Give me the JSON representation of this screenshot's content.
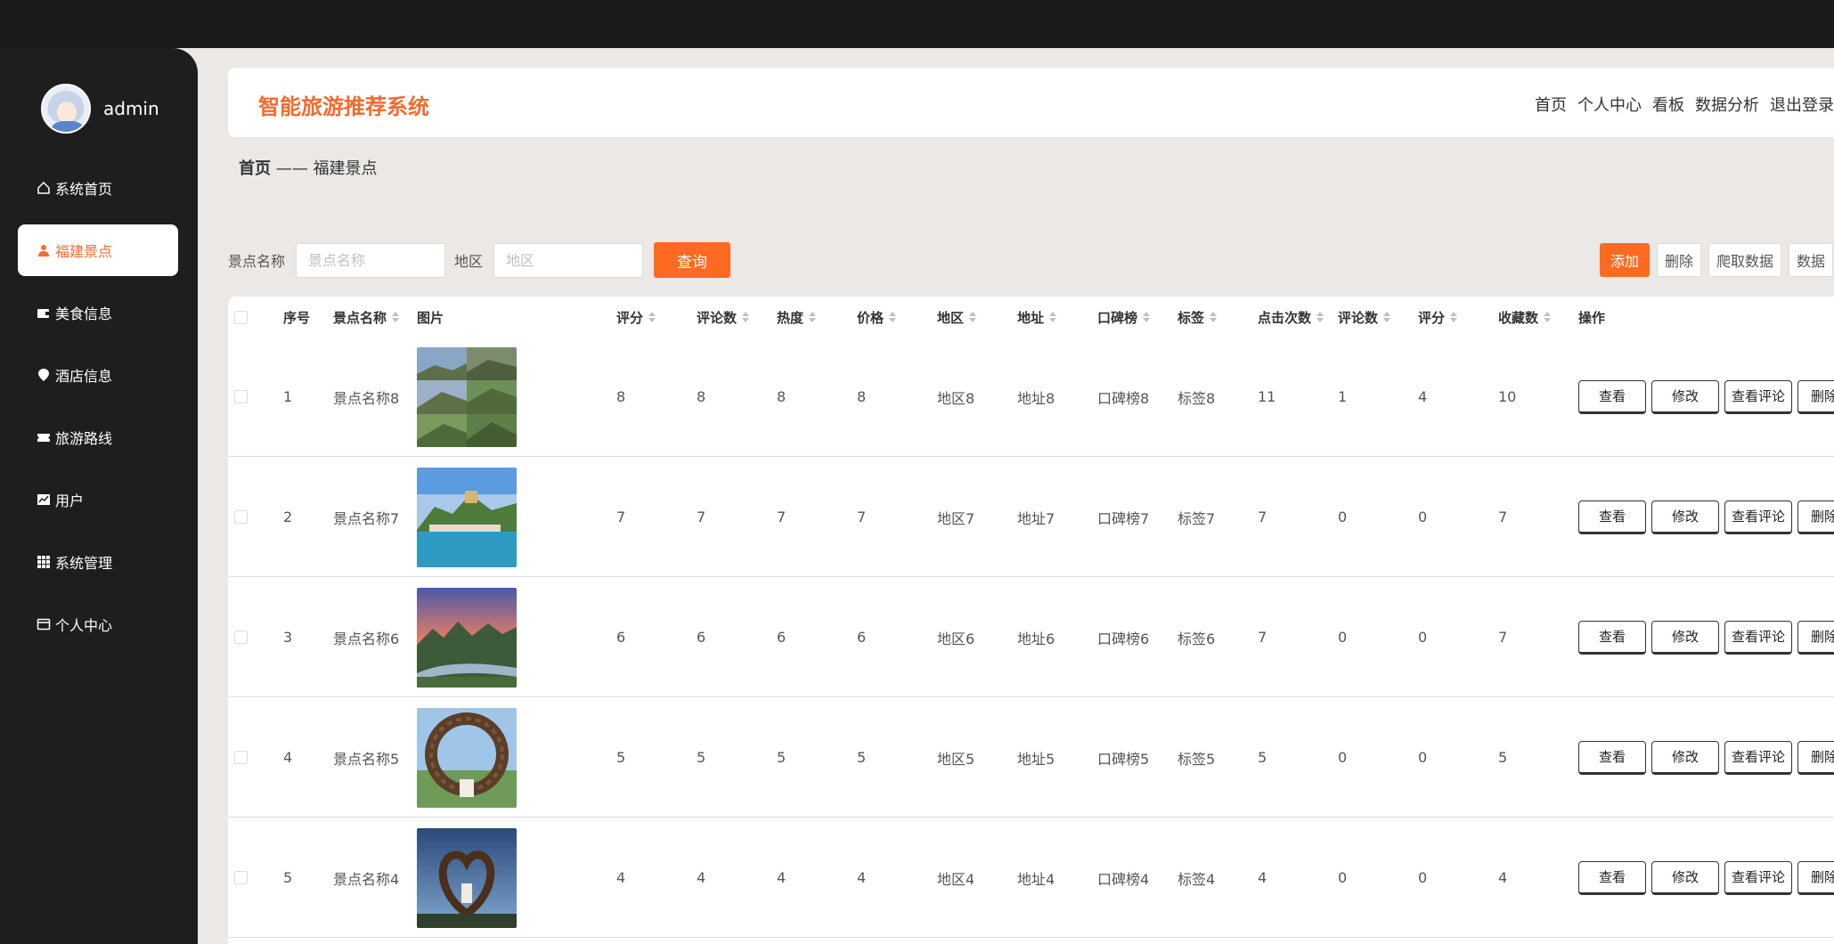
{
  "sidebar": {
    "username": "admin",
    "items": [
      {
        "label": "系统首页",
        "icon": "home-icon"
      },
      {
        "label": "福建景点",
        "icon": "user-icon"
      },
      {
        "label": "美食信息",
        "icon": "wallet-icon"
      },
      {
        "label": "酒店信息",
        "icon": "location-pin-icon"
      },
      {
        "label": "旅游路线",
        "icon": "ticket-icon"
      },
      {
        "label": "用户",
        "icon": "chart-icon"
      },
      {
        "label": "系统管理",
        "icon": "grid-icon"
      },
      {
        "label": "个人中心",
        "icon": "card-icon"
      }
    ]
  },
  "header": {
    "title": "智能旅游推荐系统",
    "nav": [
      "首页",
      "个人中心",
      "看板",
      "数据分析",
      "退出登录"
    ]
  },
  "breadcrumb": {
    "home": "首页",
    "separator": "——",
    "current": "福建景点"
  },
  "search": {
    "name_label": "景点名称",
    "name_placeholder": "景点名称",
    "region_label": "地区",
    "region_placeholder": "地区",
    "query_button": "查询"
  },
  "actions": {
    "add": "添加",
    "delete": "删除",
    "crawl": "爬取数据",
    "data": "数据"
  },
  "table": {
    "headers": [
      "序号",
      "景点名称",
      "图片",
      "评分",
      "评论数",
      "热度",
      "价格",
      "地区",
      "地址",
      "口碑榜",
      "标签",
      "点击次数",
      "评论数",
      "评分",
      "收藏数",
      "操作"
    ],
    "row_buttons": {
      "view": "查看",
      "edit": "修改",
      "comments": "查看评论",
      "delete": "删除"
    },
    "rows": [
      {
        "index": "1",
        "name": "景点名称8",
        "rating": "8",
        "comments": "8",
        "heat": "8",
        "price": "8",
        "region": "地区8",
        "address": "地址8",
        "reputation": "口碑榜8",
        "tag": "标签8",
        "clicks": "11",
        "comment_count": "1",
        "score": "4",
        "favorites": "10"
      },
      {
        "index": "2",
        "name": "景点名称7",
        "rating": "7",
        "comments": "7",
        "heat": "7",
        "price": "7",
        "region": "地区7",
        "address": "地址7",
        "reputation": "口碑榜7",
        "tag": "标签7",
        "clicks": "7",
        "comment_count": "0",
        "score": "0",
        "favorites": "7"
      },
      {
        "index": "3",
        "name": "景点名称6",
        "rating": "6",
        "comments": "6",
        "heat": "6",
        "price": "6",
        "region": "地区6",
        "address": "地址6",
        "reputation": "口碑榜6",
        "tag": "标签6",
        "clicks": "7",
        "comment_count": "0",
        "score": "0",
        "favorites": "7"
      },
      {
        "index": "4",
        "name": "景点名称5",
        "rating": "5",
        "comments": "5",
        "heat": "5",
        "price": "5",
        "region": "地区5",
        "address": "地址5",
        "reputation": "口碑榜5",
        "tag": "标签5",
        "clicks": "5",
        "comment_count": "0",
        "score": "0",
        "favorites": "5"
      },
      {
        "index": "5",
        "name": "景点名称4",
        "rating": "4",
        "comments": "4",
        "heat": "4",
        "price": "4",
        "region": "地区4",
        "address": "地址4",
        "reputation": "口碑榜4",
        "tag": "标签4",
        "clicks": "4",
        "comment_count": "0",
        "score": "0",
        "favorites": "4"
      }
    ]
  },
  "colors": {
    "accent": "#ff6a22",
    "sidebar_bg": "#1e1e1e",
    "page_bg": "#ebe8e5"
  }
}
